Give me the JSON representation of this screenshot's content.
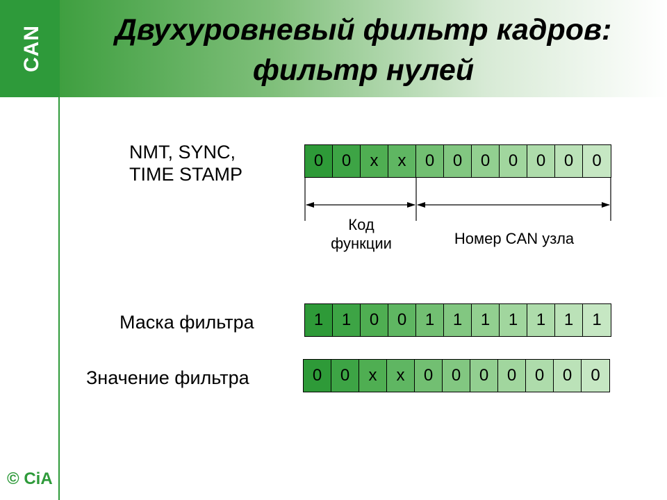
{
  "logo": {
    "text": "CAN"
  },
  "title": {
    "line1": "Двухуровневый фильтр кадров:",
    "line2": "фильтр нулей"
  },
  "id_row": {
    "label_line1": "NMT, SYNC,",
    "label_line2": "TIME STAMP",
    "bits": [
      "0",
      "0",
      "x",
      "x",
      "0",
      "0",
      "0",
      "0",
      "0",
      "0",
      "0"
    ]
  },
  "annotations": {
    "function_code_line1": "Код",
    "function_code_line2": "функции",
    "node_number": "Номер CAN узла"
  },
  "mask_row": {
    "label": "Маска фильтра",
    "bits": [
      "1",
      "1",
      "0",
      "0",
      "1",
      "1",
      "1",
      "1",
      "1",
      "1",
      "1"
    ]
  },
  "value_row": {
    "label": "Значение фильтра",
    "bits": [
      "0",
      "0",
      "x",
      "x",
      "0",
      "0",
      "0",
      "0",
      "0",
      "0",
      "0"
    ]
  },
  "cell_colors": [
    "#2e9a38",
    "#3da445",
    "#4fae52",
    "#5fb662",
    "#72bf72",
    "#82c781",
    "#92cf90",
    "#a1d69e",
    "#aedcab",
    "#bbe2b8",
    "#c6e7c3"
  ],
  "copyright": {
    "text": "© CiA"
  }
}
